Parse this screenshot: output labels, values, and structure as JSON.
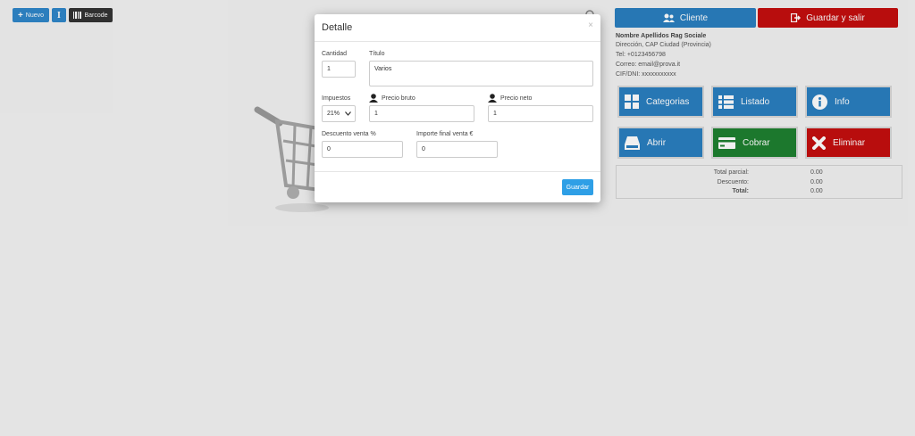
{
  "toolbar": {
    "nuevo_label": "Nuevo",
    "text_icon_glyph": "I",
    "barcode_label": "Barcode"
  },
  "header": {
    "cliente_label": "Cliente",
    "guardar_salir_label": "Guardar y salir"
  },
  "customer": {
    "name": "Nombre Apellidos Rag Sociale",
    "address": "Dirección, CAP Ciudad (Provincia)",
    "tel": "Tel: +0123456798",
    "email": "Correo: email@prova.it",
    "cif": "CIF/DNI: xxxxxxxxxxx"
  },
  "actions": {
    "categorias": "Categorias",
    "listado": "Listado",
    "info": "Info",
    "abrir": "Abrir",
    "cobrar": "Cobrar",
    "eliminar": "Eliminar"
  },
  "totals": {
    "parcial_label": "Total parcial:",
    "parcial_value": "0.00",
    "descuento_label": "Descuento:",
    "descuento_value": "0.00",
    "total_label": "Total:",
    "total_value": "0.00"
  },
  "modal": {
    "title": "Detalle",
    "close_glyph": "×",
    "cantidad_label": "Cantidad",
    "cantidad_value": "1",
    "titulo_label": "Título",
    "titulo_value": "Varios",
    "impuestos_label": "Impuestos",
    "impuestos_value": "21%",
    "precio_bruto_label": "Precio bruto",
    "precio_bruto_value": "1",
    "precio_neto_label": "Precio neto",
    "precio_neto_value": "1",
    "descuento_label": "Descuento venta %",
    "descuento_value": "0",
    "importe_label": "Importe final venta €",
    "importe_value": "0",
    "guardar_label": "Guardar"
  },
  "icons": {
    "plus": "plus-icon",
    "text": "text-icon",
    "barcode": "barcode-icon",
    "cart": "shopping-cart-icon",
    "search": "search-icon",
    "users": "users-icon",
    "signout": "sign-out-icon",
    "grid": "grid-icon",
    "list": "list-icon",
    "info": "info-icon",
    "drive": "drive-icon",
    "card": "credit-card-icon",
    "close": "close-x-icon",
    "user": "user-icon"
  },
  "colors": {
    "blue": "#2a7fc0",
    "green": "#1e8030",
    "red": "#c40e0e",
    "save": "#2e9fe6"
  }
}
